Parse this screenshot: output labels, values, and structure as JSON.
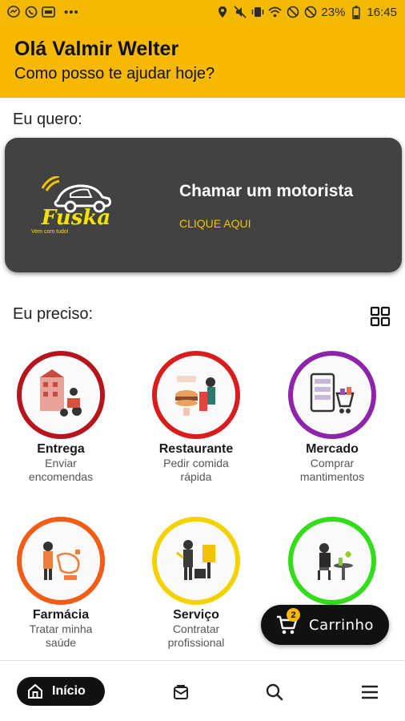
{
  "status_bar": {
    "battery_percent": "23%",
    "time": "16:45",
    "left_icons": [
      "messenger-icon",
      "whatsapp-icon",
      "app-icon",
      "more-dots-icon"
    ],
    "right_icons": [
      "location-icon",
      "mute-icon",
      "vibrate-icon",
      "wifi-icon",
      "do-not-disturb-icon",
      "no-sim-icon",
      "battery-icon"
    ]
  },
  "header": {
    "greeting": "Olá Valmir Welter",
    "subtitle": "Como posso te ajudar hoje?",
    "background_color": "#f6b800"
  },
  "section_want": {
    "label": "Eu quero:"
  },
  "driver_card": {
    "title": "Chamar um motorista",
    "link": "CLIQUE AQUI",
    "logo_text": "Fuska",
    "logo_tagline": "Vem com tudo!",
    "background_color": "#424242",
    "link_color": "#f2c200"
  },
  "section_need": {
    "label": "Eu preciso:"
  },
  "services": [
    {
      "title": "Entrega",
      "subtitle_1": "Enviar",
      "subtitle_2": "encomendas",
      "ring_color": "#b5151d"
    },
    {
      "title": "Restaurante",
      "subtitle_1": "Pedir comida",
      "subtitle_2": "rápida",
      "ring_color": "#d91c1c"
    },
    {
      "title": "Mercado",
      "subtitle_1": "Comprar",
      "subtitle_2": "mantimentos",
      "ring_color": "#8e24aa"
    },
    {
      "title": "Farmácia",
      "subtitle_1": "Tratar minha",
      "subtitle_2": "saúde",
      "ring_color": "#f25c16"
    },
    {
      "title": "Serviço",
      "subtitle_1": "Contratar",
      "subtitle_2": "profissional",
      "ring_color": "#f2d200"
    },
    {
      "title": "",
      "subtitle_1": "",
      "subtitle_2": "",
      "ring_color": "#33dd1b"
    }
  ],
  "cart": {
    "label": "Carrinho",
    "count": "2"
  },
  "bottom_nav": {
    "home_label": "Início",
    "items": [
      "home-icon",
      "bag-icon",
      "search-icon",
      "menu-icon"
    ]
  }
}
